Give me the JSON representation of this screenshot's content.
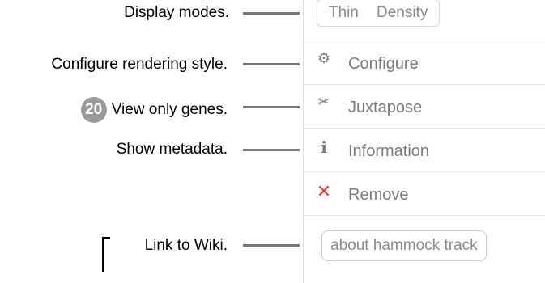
{
  "annotations": [
    {
      "text": "Display modes."
    },
    {
      "text": "Configure rendering style."
    },
    {
      "text": "View only genes.",
      "badge": "20"
    },
    {
      "text": "Show metadata."
    },
    {
      "text": "Link to Wiki."
    }
  ],
  "panel": {
    "modes": [
      "Thin",
      "Density"
    ],
    "items": [
      {
        "icon": "gear-icon",
        "glyph": "⚙",
        "label": "Configure"
      },
      {
        "icon": "scissors-icon",
        "glyph": "✂",
        "label": "Juxtapose"
      },
      {
        "icon": "info-icon",
        "glyph": "i",
        "label": "Information"
      },
      {
        "icon": "close-icon",
        "glyph": "✕",
        "label": "Remove",
        "color": "#e8352a"
      }
    ],
    "about_label": "about hammock track"
  }
}
